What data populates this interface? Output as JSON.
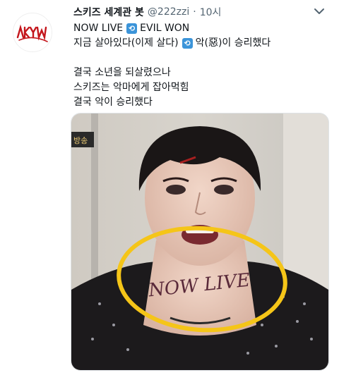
{
  "account": {
    "display_name": "스키즈 세계관 봇",
    "handle": "@222zzi",
    "separator": "·",
    "time": "10시",
    "avatar_logo_text": "SKZ"
  },
  "tweet": {
    "line1": {
      "before": "NOW LIVE",
      "badge": "⟲",
      "after": "EVIL WON"
    },
    "line2": {
      "before": "지금 살아있다(이제 살다)",
      "badge": "⟲",
      "after": "악(惡)이 승리했다"
    },
    "line3": "결국 소년을 되살렸으나",
    "line4": "스키즈는 악마에게 잡아먹힘",
    "line5": "결국 악이 승리했다"
  },
  "media": {
    "corner_tag": "방송",
    "neck_text": "NOW LIVE",
    "annotation_color": "#f5c518"
  },
  "colors": {
    "text": "#0f1419",
    "muted": "#536471",
    "badge": "#3b94d9"
  }
}
